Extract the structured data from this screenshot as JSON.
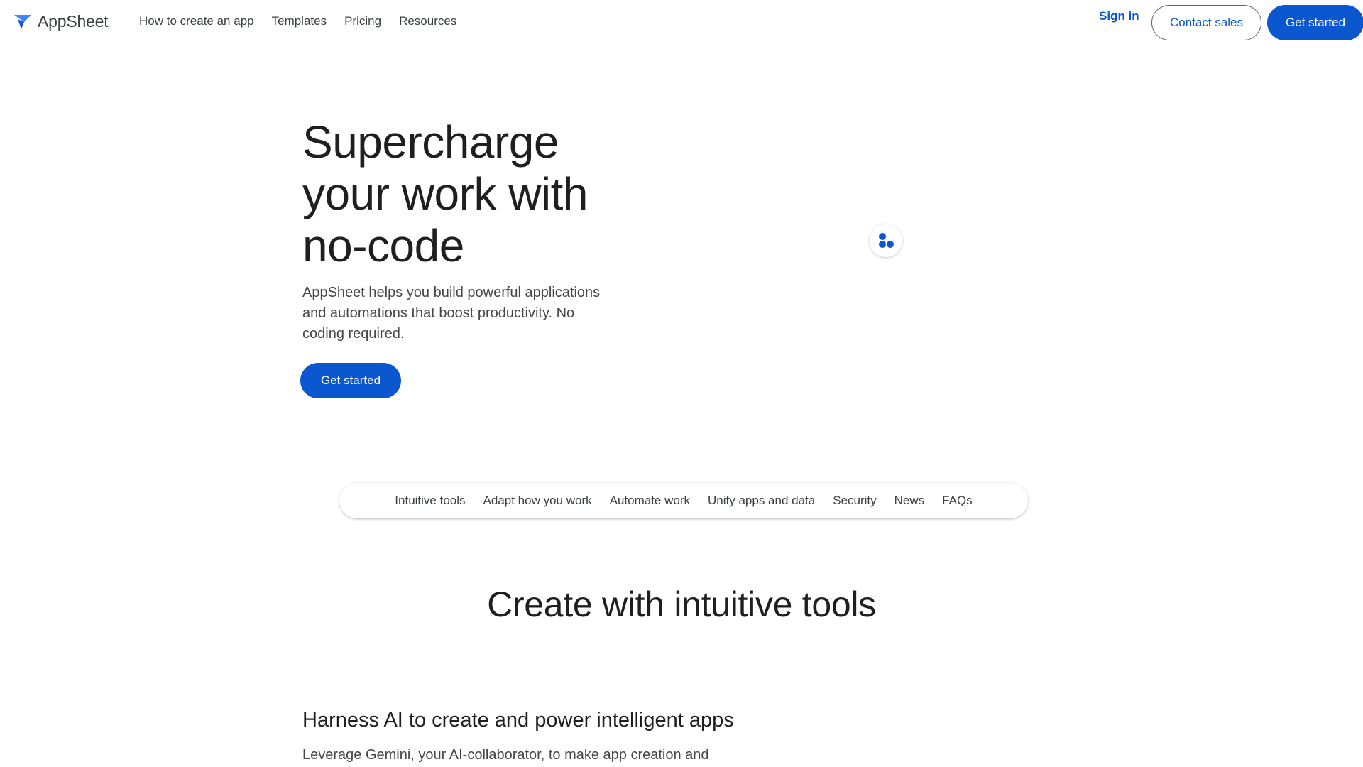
{
  "header": {
    "logo_text": "AppSheet",
    "nav": [
      {
        "label": "How to create an app"
      },
      {
        "label": "Templates"
      },
      {
        "label": "Pricing"
      },
      {
        "label": "Resources"
      }
    ],
    "sign_in": "Sign in",
    "contact_sales": "Contact sales",
    "get_started": "Get started"
  },
  "hero": {
    "title_line1": "Supercharge",
    "title_line2": "your work with",
    "title_line3": "no-code",
    "subtitle": "AppSheet helps you build powerful applications and automations that boost productivity. No coding required.",
    "cta": "Get started",
    "badge_icon": "dots-cluster-icon"
  },
  "section_nav": [
    {
      "label": "Intuitive tools"
    },
    {
      "label": "Adapt how you work"
    },
    {
      "label": "Automate work"
    },
    {
      "label": "Unify apps and data"
    },
    {
      "label": "Security"
    },
    {
      "label": "News"
    },
    {
      "label": "FAQs"
    }
  ],
  "section": {
    "title": "Create with intuitive tools",
    "feature_title": "Harness AI to create and power intelligent apps",
    "feature_desc": "Leverage Gemini, your AI-collaborator, to make app creation and"
  },
  "colors": {
    "brand_blue": "#0b57d0",
    "text_primary": "#1f1f1f",
    "text_secondary": "#444746"
  }
}
